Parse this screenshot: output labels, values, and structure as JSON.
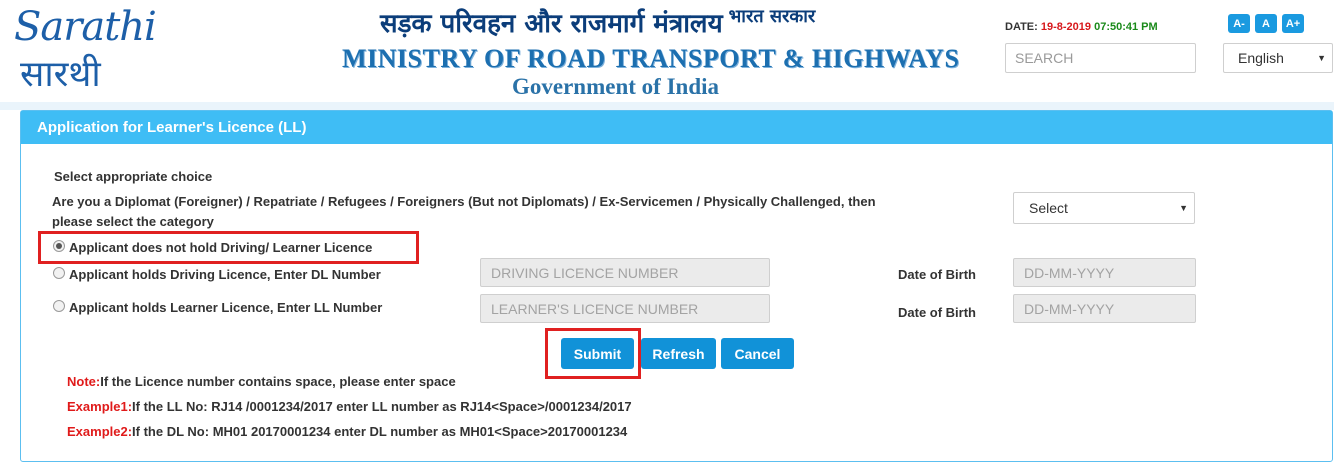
{
  "header": {
    "logo_en": "Sarathi",
    "logo_hi": "सारथी",
    "ministry_hindi": "सड़क परिवहन और राजमार्ग मंत्रालय",
    "gov_hindi": "भारत सरकार",
    "ministry_en": "MINISTRY OF ROAD TRANSPORT & HIGHWAYS",
    "gov_en": "Government of India",
    "date_label": "DATE: ",
    "date_value": "19-8-2019",
    "time_value": "07:50:41 PM",
    "font_decrease": "A-",
    "font_normal": "A",
    "font_increase": "A+",
    "search_placeholder": "SEARCH",
    "language": "English"
  },
  "panel": {
    "title": "Application for Learner's Licence (LL)",
    "select_choice": "Select appropriate choice",
    "category_line1": "Are you a Diplomat (Foreigner) / Repatriate / Refugees / Foreigners (But not Diplomats) / Ex-Servicemen / Physically Challenged, then",
    "category_line2": "please select the category",
    "category_select": "Select",
    "options": [
      {
        "label": "Applicant does not hold Driving/ Learner Licence",
        "checked": true
      },
      {
        "label": "Applicant holds Driving Licence, Enter DL Number",
        "checked": false
      },
      {
        "label": "Applicant holds Learner Licence, Enter LL Number",
        "checked": false
      }
    ],
    "dl_placeholder": "DRIVING LICENCE NUMBER",
    "ll_placeholder": "LEARNER'S LICENCE NUMBER",
    "dob_label": "Date of Birth",
    "dob_placeholder": "DD-MM-YYYY",
    "buttons": {
      "submit": "Submit",
      "refresh": "Refresh",
      "cancel": "Cancel"
    },
    "notes": [
      {
        "label": "Note:",
        "text": "If the Licence number contains space, please enter space"
      },
      {
        "label": "Example1:",
        "text": "If the LL No: RJ14 /0001234/2017 enter LL number as RJ14<Space>/0001234/2017"
      },
      {
        "label": "Example2:",
        "text": "If the DL No: MH01 20170001234 enter DL number as MH01<Space>20170001234"
      }
    ]
  },
  "colors": {
    "panel_header": "#3fbdf5",
    "button": "#1192d8",
    "highlight": "#e02020",
    "note_label": "#e01a1a"
  }
}
